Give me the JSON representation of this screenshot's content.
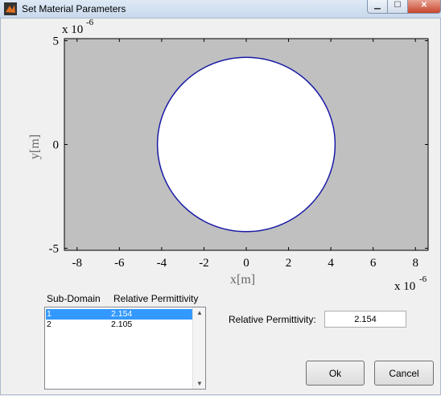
{
  "window": {
    "title": "Set Material Parameters"
  },
  "chart_data": {
    "type": "scatter",
    "title": "",
    "xlabel": "x[m]",
    "ylabel": "y[m]",
    "x_exponent": "x 10",
    "y_exponent": "x 10",
    "exponent_power": "-6",
    "xlim": [
      -8.6,
      8.6
    ],
    "ylim": [
      -5.1,
      5.1
    ],
    "xticks": [
      -8,
      -6,
      -4,
      -2,
      0,
      2,
      4,
      6,
      8
    ],
    "yticks": [
      -5,
      0,
      5
    ],
    "xtick_labels": [
      "-8",
      "-6",
      "-4",
      "-2",
      "0",
      "2",
      "4",
      "6",
      "8"
    ],
    "ytick_labels": [
      "-5",
      "0",
      "5"
    ],
    "background_color": "#c0c0c0",
    "shapes": [
      {
        "kind": "circle",
        "cx": 0,
        "cy": 0,
        "r": 4.2,
        "fill": "#ffffff",
        "stroke": "#1a1aa6"
      }
    ]
  },
  "table": {
    "col1_header": "Sub-Domain",
    "col2_header": "Relative Permittivity",
    "rows": [
      {
        "id": "1",
        "value": "2.154",
        "selected": true
      },
      {
        "id": "2",
        "value": "2.105",
        "selected": false
      }
    ]
  },
  "permittivity": {
    "label": "Relative Permittivity:",
    "value": "2.154"
  },
  "buttons": {
    "ok": "Ok",
    "cancel": "Cancel"
  },
  "colors": {
    "selection": "#3399ff",
    "circle_edge": "#1a1aa6",
    "plot_bg": "#c0c0c0"
  }
}
